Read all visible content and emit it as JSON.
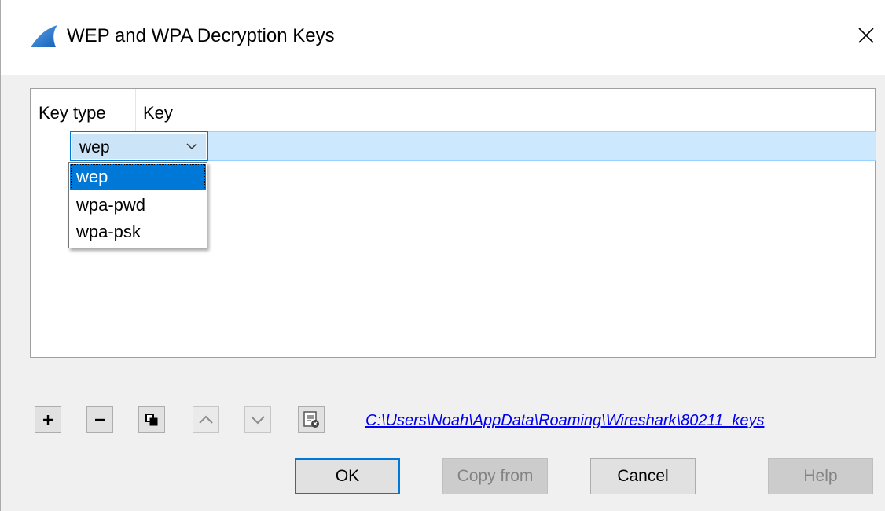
{
  "window": {
    "title": "WEP and WPA Decryption Keys",
    "icon": "wireshark-fin-icon",
    "close_icon": "close-icon"
  },
  "table": {
    "columns": [
      "Key type",
      "Key"
    ],
    "rows": [
      {
        "key_type": "wep",
        "key": ""
      }
    ]
  },
  "combo": {
    "value": "wep",
    "options": [
      "wep",
      "wpa-pwd",
      "wpa-psk"
    ],
    "selected_option": "wep"
  },
  "toolbar": {
    "buttons": [
      {
        "name": "add",
        "icon": "plus-icon",
        "enabled": true
      },
      {
        "name": "remove",
        "icon": "minus-icon",
        "enabled": true
      },
      {
        "name": "copy",
        "icon": "copy-icon",
        "enabled": true
      },
      {
        "name": "move-up",
        "icon": "chevron-up-icon",
        "enabled": false
      },
      {
        "name": "move-down",
        "icon": "chevron-down-icon",
        "enabled": false
      },
      {
        "name": "clear",
        "icon": "clear-list-icon",
        "enabled": true
      }
    ],
    "file_path": "C:\\Users\\Noah\\AppData\\Roaming\\Wireshark\\80211_keys"
  },
  "buttons": {
    "ok": "OK",
    "copy_from": "Copy from",
    "cancel": "Cancel",
    "help": "Help"
  },
  "colors": {
    "selection_blue": "#0078d7",
    "row_highlight": "#cce8ff",
    "link": "#0000ee"
  }
}
